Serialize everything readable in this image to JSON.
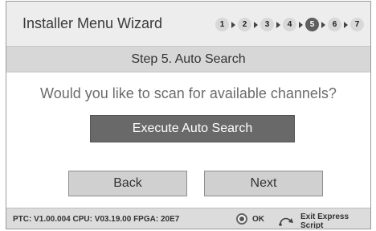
{
  "header": {
    "title": "Installer Menu Wizard",
    "steps": [
      "1",
      "2",
      "3",
      "4",
      "5",
      "6",
      "7"
    ],
    "current_step": "5"
  },
  "banner": {
    "text": "Step 5. Auto Search"
  },
  "question": {
    "text": "Would you like to scan for available channels?"
  },
  "actions": {
    "execute_label": "Execute Auto Search",
    "back_label": "Back",
    "next_label": "Next"
  },
  "footer": {
    "info": "PTC: V1.00.004 CPU: V03.19.00 FPGA: 20E7",
    "ok_label": "OK",
    "exit_label": "Exit Express Script",
    "ok_icon": "ok-button-icon",
    "exit_icon": "return-icon"
  },
  "colors": {
    "header_bg": "#ededed",
    "banner_bg": "#d7d7d7",
    "primary_button": "#696969",
    "current_step": "#5f5f5f"
  }
}
